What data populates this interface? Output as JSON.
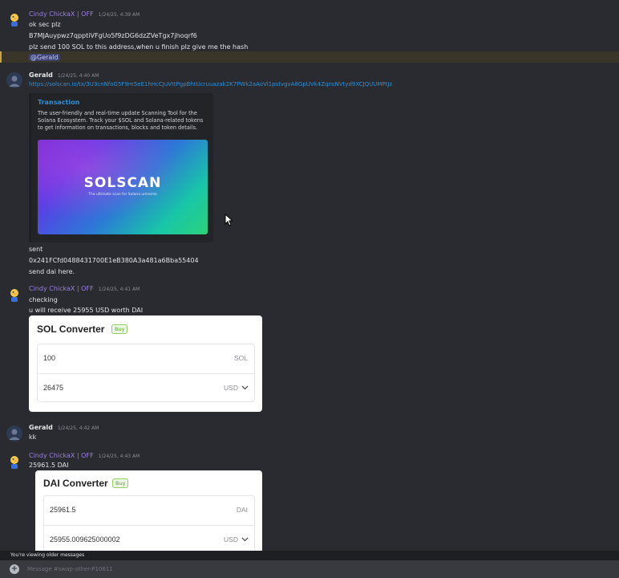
{
  "messages": {
    "m1": {
      "author": "Cindy ChickaX | OFF",
      "timestamp": "1/24/25, 4:39 AM",
      "lines": [
        "ok sec plz",
        "B7MJAuypwz7qpptiVFgUo5f9zDG6dzZVeTgx7jhoqrf6",
        "plz send 100 SOL to this address,when u finish plz give me the hash"
      ],
      "mention": "@Gerald"
    },
    "m2": {
      "author": "Gerald",
      "timestamp": "1/24/25, 4:40 AM",
      "link": "https://solscan.io/tx/3U3cnNfoG5F9m5eE1hHcCJuVttPgpBhtUcruuazak2K7PWk2aAoVi1pstvgvA8GpUVk4ZqnsNVtyd9XCJQUUMPtJz",
      "embed": {
        "title": "Transaction",
        "description": "The user-friendly and real-time update Scanning Tool for the Solana Ecosystem. Track your $SOL and Solana-related tokens to get information on transactions, blocks and token details.",
        "image_logo": "SOLSCAN",
        "image_tagline": "The ultimate scan for Solana universe"
      },
      "after_lines": [
        "sent",
        "0x241FCfd0488431700E1eB380A3a481a6Bba55404",
        "send dai here."
      ]
    },
    "m3": {
      "author": "Cindy ChickaX | OFF",
      "timestamp": "1/24/25, 4:41 AM",
      "lines": [
        "checking",
        "u will receive 25955 USD worth DAI"
      ],
      "card": {
        "title": "SOL Converter",
        "badge": "Buy",
        "from_value": "100",
        "from_unit": "SOL",
        "to_value": "26475",
        "to_unit": "USD"
      }
    },
    "m4": {
      "author": "Gerald",
      "timestamp": "1/24/25, 4:42 AM",
      "lines": [
        "kk"
      ]
    },
    "m5": {
      "author": "Cindy ChickaX | OFF",
      "timestamp": "1/24/25, 4:43 AM",
      "lines": [
        "25961.5 DAI"
      ],
      "card": {
        "title": "DAI Converter",
        "badge": "Buy",
        "from_value": "25961.5",
        "from_unit": "DAI",
        "to_value": "25955.009625000002",
        "to_unit": "USD"
      }
    }
  },
  "status_bar": {
    "text": "You're viewing older messages"
  },
  "composer": {
    "placeholder": "Message #swap-other-P10611"
  },
  "colors": {
    "background": "#2a2b30",
    "link": "#2b8fd6",
    "cindy_name": "#9b7fe0",
    "badge_green": "#5aa02c"
  }
}
